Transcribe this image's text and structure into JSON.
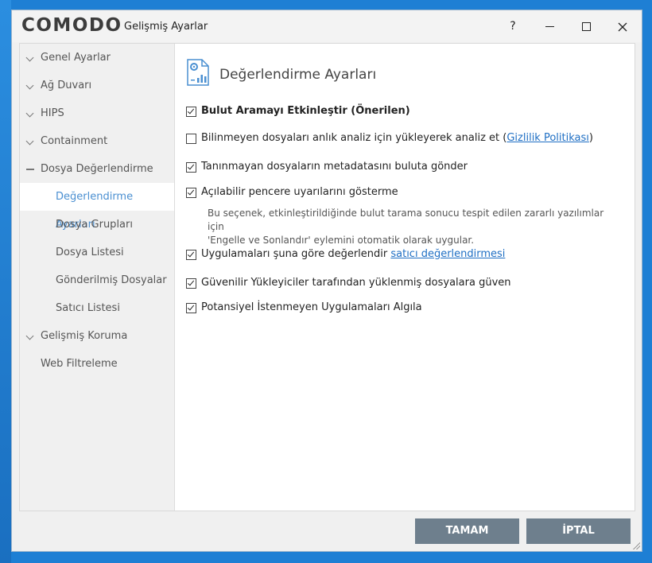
{
  "window": {
    "logo": "COMODO",
    "title": "Gelişmiş Ayarlar",
    "help_label": "?"
  },
  "sidebar": {
    "items": [
      {
        "label": "Genel Ayarlar"
      },
      {
        "label": "Ağ Duvarı"
      },
      {
        "label": "HIPS"
      },
      {
        "label": "Containment"
      },
      {
        "label": "Dosya Değerlendirme"
      },
      {
        "label": "Değerlendirme Ayarları"
      },
      {
        "label": "Dosya Grupları"
      },
      {
        "label": "Dosya Listesi"
      },
      {
        "label": "Gönderilmiş Dosyalar"
      },
      {
        "label": "Satıcı Listesi"
      },
      {
        "label": "Gelişmiş Koruma"
      },
      {
        "label": "Web Filtreleme"
      }
    ]
  },
  "panel": {
    "title": "Değerlendirme Ayarları",
    "options": [
      {
        "label": "Bulut Aramayı Etkinleştir (Önerilen)",
        "checked": true
      },
      {
        "label_before": "Bilinmeyen dosyaları anlık analiz için yükleyerek analiz et (",
        "link": "Gizlilik Politikası",
        "label_after": ")",
        "checked": false
      },
      {
        "label": "Tanınmayan dosyaların metadatasını buluta gönder",
        "checked": true
      },
      {
        "label": "Açılabilir pencere uyarılarını gösterme",
        "checked": true
      },
      {
        "label_before": "Uygulamaları şuna göre değerlendir ",
        "link": "satıcı değerlendirmesi",
        "checked": true
      },
      {
        "label": "Güvenilir Yükleyiciler tarafından yüklenmiş dosyalara güven",
        "checked": true
      },
      {
        "label": "Potansiyel İstenmeyen Uygulamaları Algıla",
        "checked": true
      }
    ],
    "description_line1": "Bu seçenek, etkinleştirildiğinde bulut tarama sonucu tespit edilen zararlı yazılımlar için",
    "description_line2": "'Engelle ve Sonlandır' eylemini otomatik olarak uygular."
  },
  "footer": {
    "ok_label": "TAMAM",
    "cancel_label": "İPTAL"
  }
}
